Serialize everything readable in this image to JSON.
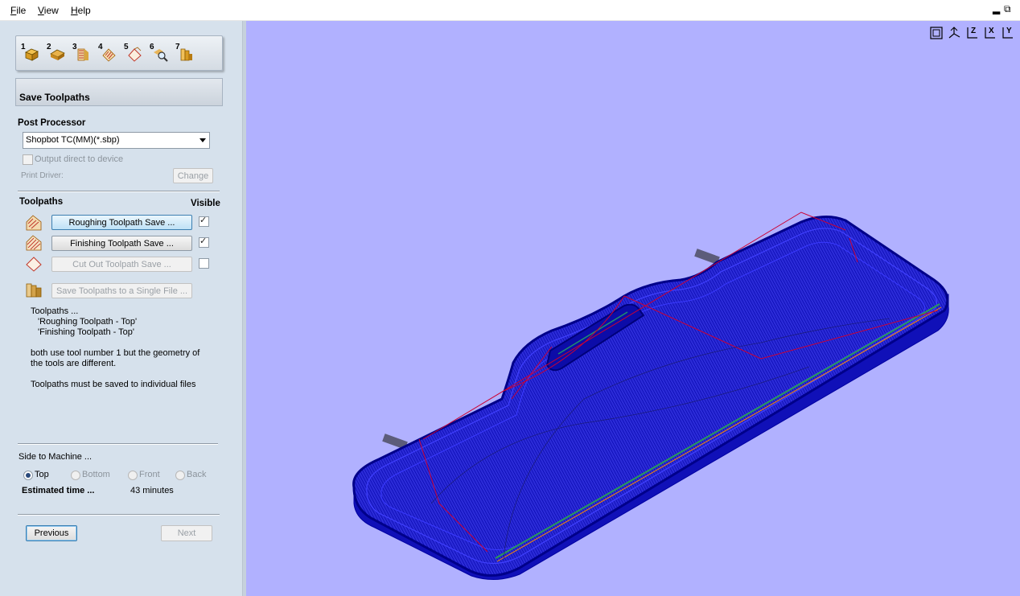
{
  "menu": {
    "file": "File",
    "view": "View",
    "help": "Help"
  },
  "window_controls": {
    "minimize": "▂",
    "restore": "⧉"
  },
  "toolbar": {
    "steps": [
      "1",
      "2",
      "3",
      "4",
      "5",
      "6",
      "7"
    ]
  },
  "page_title": "Save Toolpaths",
  "post_processor": {
    "label": "Post Processor",
    "selected": "Shopbot TC(MM)(*.sbp)",
    "output_direct_label": "Output direct to device",
    "output_direct_checked": false,
    "print_driver_label": "Print Driver:",
    "change_button": "Change"
  },
  "toolpaths": {
    "header": "Toolpaths",
    "visible_header": "Visible",
    "items": [
      {
        "label": "Roughing Toolpath Save ...",
        "visible": true,
        "enabled": true
      },
      {
        "label": "Finishing Toolpath Save ...",
        "visible": true,
        "enabled": true
      },
      {
        "label": "Cut Out Toolpath Save ...",
        "visible": false,
        "enabled": false
      }
    ],
    "save_single_button": "Save Toolpaths to a Single File ..."
  },
  "info": {
    "line1": "Toolpaths ...",
    "line2": "'Roughing Toolpath - Top'",
    "line3": "'Finishing Toolpath  - Top'",
    "line4": "both use  tool number  1 but the geometry of",
    "line5": "the tools are different.",
    "line6": "Toolpaths must be saved to individual files"
  },
  "side": {
    "label": "Side to Machine ...",
    "options": [
      "Top",
      "Bottom",
      "Front",
      "Back"
    ],
    "selected": "Top"
  },
  "estimate": {
    "label": "Estimated time ...",
    "value": "43 minutes"
  },
  "nav": {
    "previous": "Previous",
    "next": "Next"
  },
  "view_icons": [
    "fit-view-icon",
    "iso-view-icon",
    "z-axis-icon",
    "x-axis-icon",
    "y-axis-icon"
  ],
  "view_icon_letters": {
    "z": "Z",
    "x": "X",
    "y": "Y"
  },
  "colors": {
    "viewport_bg": "#b1b1ff",
    "toolpath_blue": "#0000cc",
    "rapid_red": "#cc0033",
    "panel_bg": "#d6e1ec"
  }
}
